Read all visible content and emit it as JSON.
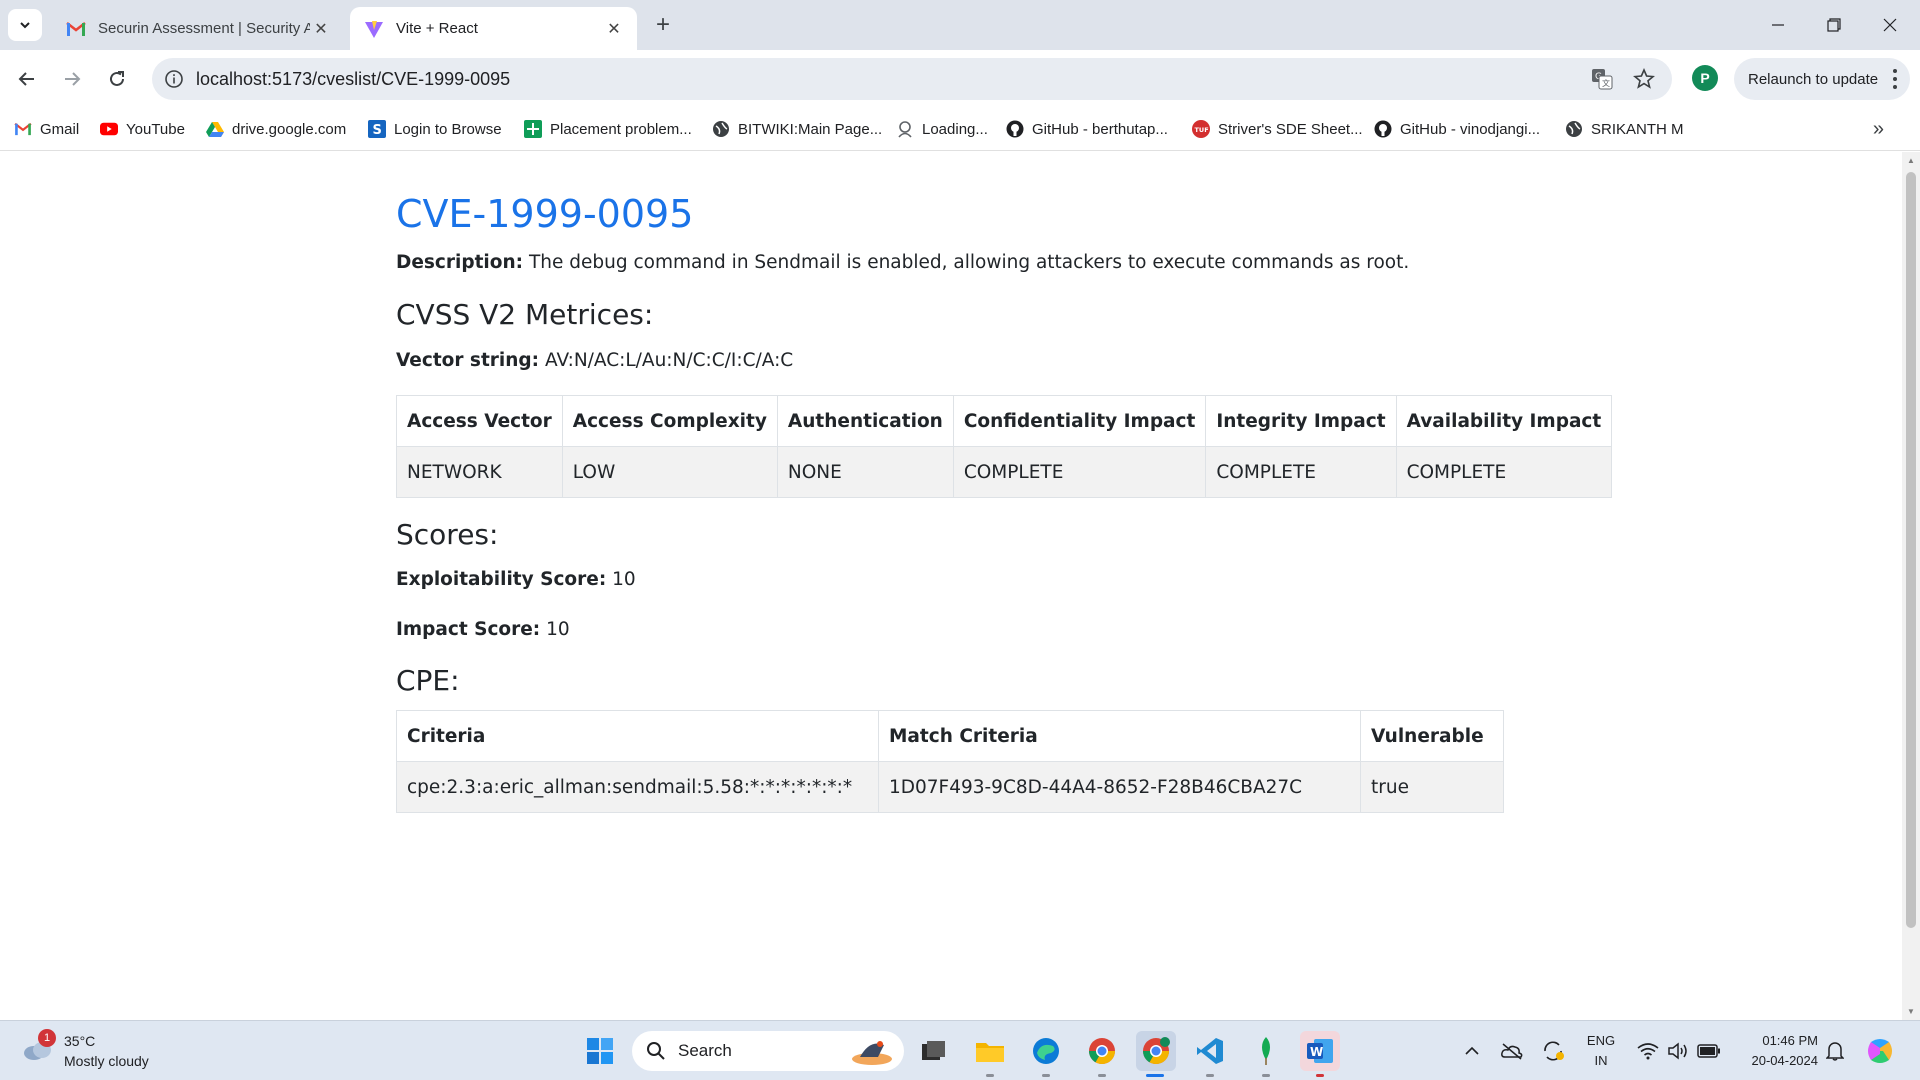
{
  "browser": {
    "tabs": [
      {
        "title": "Securin Assessment | Security A",
        "icon": "gmail-icon",
        "active": false
      },
      {
        "title": "Vite + React",
        "icon": "vite-icon",
        "active": true
      }
    ],
    "url": "localhost:5173/cveslist/CVE-1999-0095",
    "profile_initial": "P",
    "relaunch_label": "Relaunch to update",
    "bookmarks": [
      {
        "label": "Gmail",
        "icon": "gmail-icon"
      },
      {
        "label": "YouTube",
        "icon": "youtube-icon"
      },
      {
        "label": "drive.google.com",
        "icon": "google-drive-icon"
      },
      {
        "label": "Login to Browse",
        "icon": "s-logo-icon"
      },
      {
        "label": "Placement problem...",
        "icon": "sheets-icon"
      },
      {
        "label": "BITWIKI:Main Page...",
        "icon": "globe-icon"
      },
      {
        "label": "Loading...",
        "icon": "loading-icon"
      },
      {
        "label": "GitHub - berthutap...",
        "icon": "github-icon"
      },
      {
        "label": "Striver's SDE Sheet...",
        "icon": "tuf-icon"
      },
      {
        "label": "GitHub - vinodjangi...",
        "icon": "github-icon"
      },
      {
        "label": "SRIKANTH M",
        "icon": "globe-icon"
      }
    ]
  },
  "cve": {
    "id": "CVE-1999-0095",
    "description_label": "Description:",
    "description": "The debug command in Sendmail is enabled, allowing attackers to execute commands as root.",
    "cvss_heading": "CVSS V2 Metrices:",
    "vector_label": "Vector string:",
    "vector_value": "AV:N/AC:L/Au:N/C:C/I:C/A:C",
    "metrics_table": {
      "headers": [
        "Access Vector",
        "Access Complexity",
        "Authentication",
        "Confidentiality Impact",
        "Integrity Impact",
        "Availability Impact"
      ],
      "row": [
        "NETWORK",
        "LOW",
        "NONE",
        "COMPLETE",
        "COMPLETE",
        "COMPLETE"
      ]
    },
    "scores_heading": "Scores:",
    "exploitability_label": "Exploitability Score:",
    "exploitability_value": "10",
    "impact_label": "Impact Score:",
    "impact_value": "10",
    "cpe_heading": "CPE:",
    "cpe_table": {
      "headers": [
        "Criteria",
        "Match Criteria",
        "Vulnerable"
      ],
      "row": [
        "cpe:2.3:a:eric_allman:sendmail:5.58:*:*:*:*:*:*:*",
        "1D07F493-9C8D-44A4-8652-F28B46CBA27C",
        "true"
      ]
    }
  },
  "taskbar": {
    "weather_temp": "35°C",
    "weather_condition": "Mostly cloudy",
    "weather_badge": "1",
    "search_label": "Search",
    "lang_line1": "ENG",
    "lang_line2": "IN",
    "time": "01:46 PM",
    "date": "20-04-2024"
  },
  "colors": {
    "link_blue": "#1a73e8",
    "tab_strip": "#dee3eb",
    "taskbar": "#dfe7f2"
  }
}
